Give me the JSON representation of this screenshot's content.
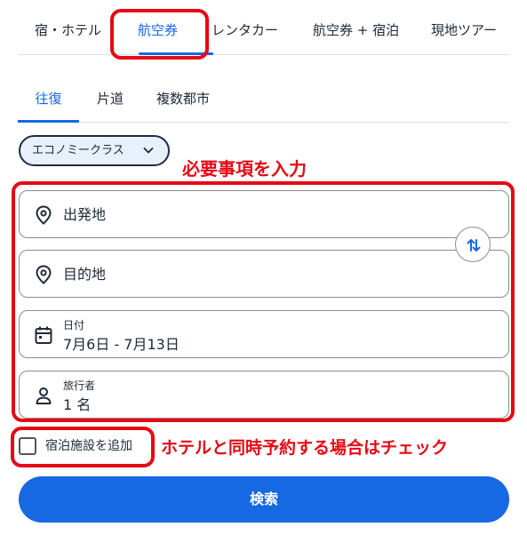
{
  "top_tabs": [
    {
      "label": "宿・ホテル"
    },
    {
      "label": "航空券"
    },
    {
      "label": "レンタカー"
    },
    {
      "label": "航空券 + 宿泊"
    },
    {
      "label": "現地ツアー"
    }
  ],
  "sub_tabs": [
    {
      "label": "往復"
    },
    {
      "label": "片道"
    },
    {
      "label": "複数都市"
    }
  ],
  "cabin_class": {
    "label": "エコノミークラス"
  },
  "origin": {
    "placeholder": "出発地"
  },
  "destination": {
    "placeholder": "目的地"
  },
  "dates": {
    "label": "日付",
    "value": "7月6日 - 7月13日"
  },
  "travelers": {
    "label": "旅行者",
    "value": "1 名"
  },
  "add_hotel": {
    "label": "宿泊施設を追加",
    "checked": false
  },
  "search_button": {
    "label": "検索"
  },
  "annotations": {
    "inputs_note": "必要事項を入力",
    "hotel_note": "ホテルと同時予約する場合はチェック"
  },
  "colors": {
    "accent": "#1668e3",
    "annotation": "#e50914"
  }
}
